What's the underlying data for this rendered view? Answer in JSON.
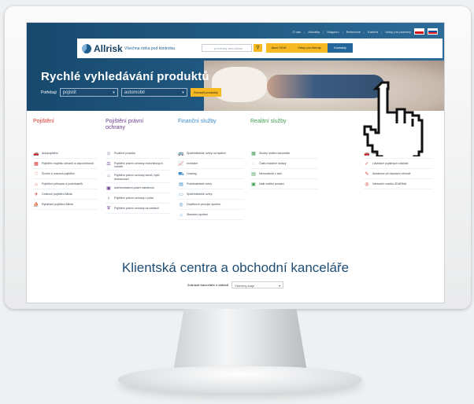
{
  "topnav": [
    "O nás",
    "Aktuality",
    "Magazín",
    "Reference",
    "Kariéra",
    "Vstup pro partnery"
  ],
  "header": {
    "logo": "Allrisk",
    "slogan_main": "Všechna rizika",
    "slogan_sub": "pod kontrolou",
    "search_placeholder": "prohledej web Allrisk",
    "btn_akce": "Akce 2018",
    "btn_vstup": "Vstup pro klienty",
    "btn_kontakty": "Kontakty"
  },
  "hero": {
    "title": "Rychlé vyhledávání produktů",
    "label": "Potřebuji",
    "select1": "pojistit",
    "select2": "automobil",
    "button": "Zobrazit produkty"
  },
  "columns": [
    {
      "title": "Pojištění",
      "color": "#d2372c",
      "items": [
        {
          "icon": "car-icon",
          "glyph": "🚗",
          "label": "Autopojištění"
        },
        {
          "icon": "building-icon",
          "glyph": "▦",
          "label": "Pojištění majetku občanů a odpovědnosti"
        },
        {
          "icon": "heart-icon",
          "glyph": "♡",
          "label": "Životní a úrazová pojištění"
        },
        {
          "icon": "factory-icon",
          "glyph": "⌂",
          "label": "Pojištění průmyslu a podnikatelů"
        },
        {
          "icon": "travel-icon",
          "glyph": "✈",
          "label": "Cestovní pojištění Allrisk"
        },
        {
          "icon": "boat-icon",
          "glyph": "⛵",
          "label": "Rybářské pojištění Allrisk"
        }
      ]
    },
    {
      "title": "Pojištění právní ochrany",
      "color": "#6a3b8f",
      "items": [
        {
          "icon": "family-icon",
          "glyph": "☺",
          "label": "Rodinné pravidlo"
        },
        {
          "icon": "car-law-icon",
          "glyph": "⚖",
          "label": "Pojištění právní ochrany motoristových vozidel"
        },
        {
          "icon": "home-law-icon",
          "glyph": "⌂",
          "label": "Pojištění právní ochrany domů, bytů, domácností"
        },
        {
          "icon": "admin-icon",
          "glyph": "▣",
          "label": "Administrativní právní asistence"
        },
        {
          "icon": "person-icon",
          "glyph": "♀",
          "label": "Pojištění právní ochrany v práci"
        },
        {
          "icon": "shield-icon",
          "glyph": "⛨",
          "label": "Pojištění právní ochrany na cestách"
        }
      ]
    },
    {
      "title": "Finanční služby",
      "color": "#3a8bc8",
      "items": [
        {
          "icon": "bus-icon",
          "glyph": "🚌",
          "label": "Spotřebitelské úvěry na bydlení"
        },
        {
          "icon": "chart-icon",
          "glyph": "📈",
          "label": "Investice"
        },
        {
          "icon": "leasing-icon",
          "glyph": "⛟",
          "label": "Leasing"
        },
        {
          "icon": "business-icon",
          "glyph": "▤",
          "label": "Podnikatelské úvěry"
        },
        {
          "icon": "card-icon",
          "glyph": "▭",
          "label": "Spotřebitelské úvěry"
        },
        {
          "icon": "pension-icon",
          "glyph": "◎",
          "label": "Doplňkové penzijní spoření"
        },
        {
          "icon": "savings-icon",
          "glyph": "⌂",
          "label": "Stavební spoření"
        }
      ]
    },
    {
      "title": "Realitní služby",
      "color": "#3e9b4f",
      "items": [
        {
          "icon": "office-icon",
          "glyph": "▦",
          "label": "Služby realitní kanceláře"
        },
        {
          "icon": "question-icon",
          "glyph": "◌",
          "label": "Často kladené dotazy"
        },
        {
          "icon": "sale-icon",
          "glyph": "▤",
          "label": "Nemovitosti v akci"
        },
        {
          "icon": "advice-icon",
          "glyph": "▣",
          "label": "Naši realitní poradci"
        }
      ]
    },
    {
      "title": "",
      "color": "#d2372c",
      "items": [
        {
          "icon": "autopojisteni-icon",
          "glyph": "🚗",
          "label": "Autopojištěmu"
        },
        {
          "icon": "check-icon",
          "glyph": "✓",
          "label": "Likvidace pojistných událostí"
        },
        {
          "icon": "assistance-icon",
          "glyph": "✎",
          "label": "Asistence při dopravní nehodě"
        },
        {
          "icon": "question-circle-icon",
          "glyph": "◎",
          "label": "Náhradní vozidlo ZDARMA"
        }
      ]
    }
  ],
  "klient": {
    "title": "Klientská centra a obchodní kanceláře",
    "label": "Zobrazit kanceláře z oblasti",
    "select": "Všechny kraje"
  }
}
